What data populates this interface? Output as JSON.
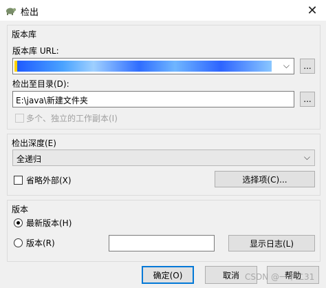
{
  "window": {
    "title": "检出",
    "close_symbol": "✕"
  },
  "repository": {
    "group_title": "版本库",
    "url_label": "版本库 URL:",
    "browse_label": "..."
  },
  "checkout_dir": {
    "label": "检出至目录(D):",
    "value": "E:\\java\\新建文件夹",
    "browse_label": "..."
  },
  "multiple_independent": {
    "label": "多个、独立的工作副本(I)"
  },
  "depth": {
    "group_title": "检出深度(E)",
    "selected": "全递归",
    "omit_externals_label": "省略外部(X)",
    "options_button": "选择项(C)..."
  },
  "revision": {
    "group_title": "版本",
    "head_label": "最新版本(H)",
    "revision_label": "版本(R)",
    "revision_value": "",
    "show_log_button": "显示日志(L)"
  },
  "footer": {
    "ok": "确定(O)",
    "cancel": "取消",
    "help": "帮助"
  },
  "watermark": "CSDN @一十二31"
}
